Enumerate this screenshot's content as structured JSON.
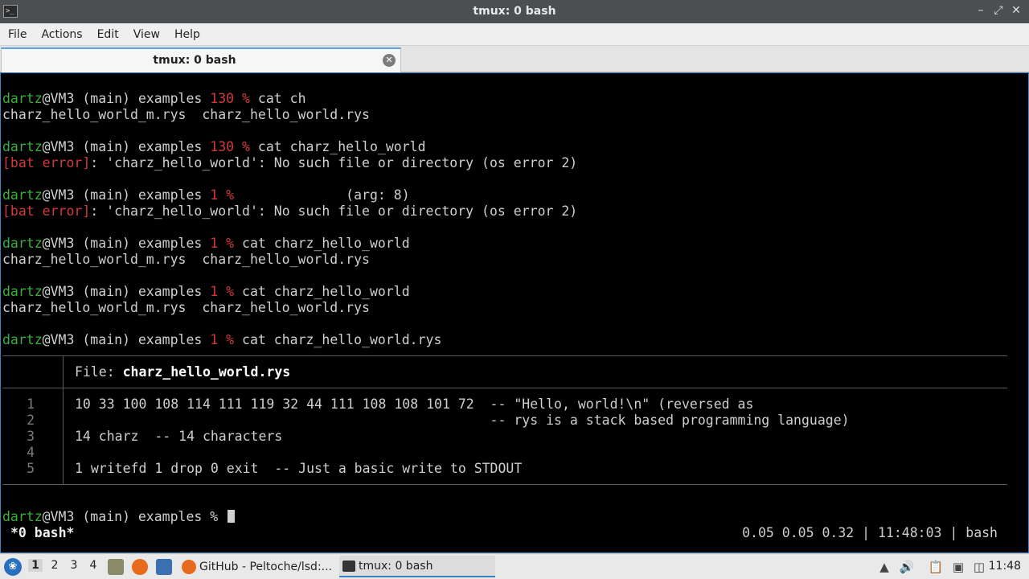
{
  "window": {
    "title": "tmux: 0 bash"
  },
  "menu": [
    "File",
    "Actions",
    "Edit",
    "View",
    "Help"
  ],
  "tab": {
    "label": "tmux: 0 bash"
  },
  "terminal": {
    "l1": {
      "user": "dartz",
      "host": "@VM3 (main) examples ",
      "status": "130 %",
      "cmd": " cat ch"
    },
    "l2": "charz_hello_world_m.rys  charz_hello_world.rys",
    "l4": {
      "user": "dartz",
      "host": "@VM3 (main) examples ",
      "status": "130 %",
      "cmd": " cat charz_hello_world"
    },
    "l5": {
      "err": "[bat error]",
      "msg": ": 'charz_hello_world': No such file or directory (os error 2)"
    },
    "l7": {
      "user": "dartz",
      "host": "@VM3 (main) examples ",
      "status": "1 %",
      "cmd": "              (arg: 8)"
    },
    "l8": {
      "err": "[bat error]",
      "msg": ": 'charz_hello_world': No such file or directory (os error 2)"
    },
    "l10": {
      "user": "dartz",
      "host": "@VM3 (main) examples ",
      "status": "1 %",
      "cmd": " cat charz_hello_world"
    },
    "l11": "charz_hello_world_m.rys  charz_hello_world.rys",
    "l13": {
      "user": "dartz",
      "host": "@VM3 (main) examples ",
      "status": "1 %",
      "cmd": " cat charz_hello_world"
    },
    "l14": "charz_hello_world_m.rys  charz_hello_world.rys",
    "l16": {
      "user": "dartz",
      "host": "@VM3 (main) examples ",
      "status": "1 %",
      "cmd": " cat charz_hello_world.rys"
    },
    "bat": {
      "file_label": "File: ",
      "file_name": "charz_hello_world.rys",
      "lines": [
        {
          "n": "1",
          "text": "10 33 100 108 114 111 119 32 44 111 108 108 101 72  -- \"Hello, world!\\n\" (reversed as"
        },
        {
          "n": "2",
          "text": "                                                    -- rys is a stack based programming language)"
        },
        {
          "n": "3",
          "text": "14 charz  -- 14 characters"
        },
        {
          "n": "4",
          "text": ""
        },
        {
          "n": "5",
          "text": "1 writefd 1 drop 0 exit  -- Just a basic write to STDOUT"
        }
      ]
    },
    "prompt": {
      "user": "dartz",
      "host": "@VM3 (main) examples % "
    },
    "status_left": "*0 bash*",
    "status_right": "0.05 0.05 0.32 | 11:48:03 | bash"
  },
  "taskbar": {
    "workspaces": [
      "1",
      "2",
      "3",
      "4"
    ],
    "tasks": [
      {
        "label": "GitHub - Peltoche/lsd:...",
        "icon": "firefox-icon"
      },
      {
        "label": "tmux: 0 bash",
        "icon": "terminal-icon"
      }
    ],
    "clock": "11:48"
  }
}
